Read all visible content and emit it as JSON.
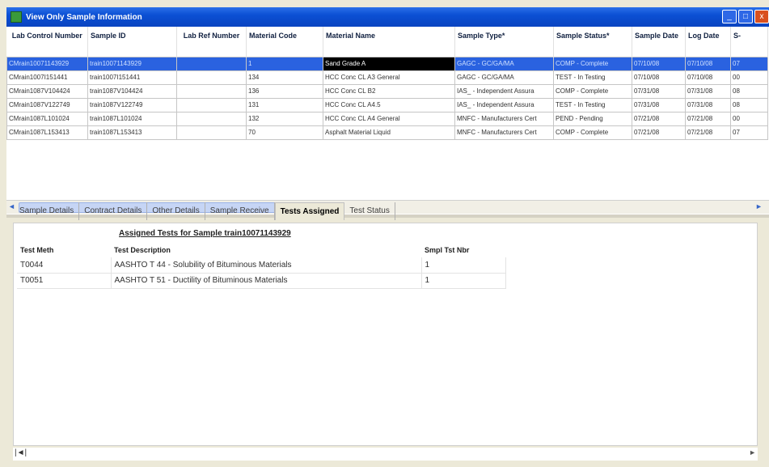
{
  "window": {
    "title": "View Only Sample Information",
    "minimize": "_",
    "maximize": "□",
    "close": "x"
  },
  "grid": {
    "columns": [
      "Lab Control Number",
      "Sample ID",
      "Lab Ref Number",
      "Material Code",
      "Material Name",
      "Sample Type*",
      "Sample Status*",
      "Sample Date",
      "Log Date",
      "S-"
    ],
    "rows": [
      [
        "CMrain10071143929",
        "train10071143929",
        "",
        "1",
        "Sand Grade A",
        "GAGC - GC/GA/MA",
        "COMP - Complete",
        "07/10/08",
        "07/10/08",
        "07"
      ],
      [
        "CMrain1007I151441",
        "train1007I151441",
        "",
        "134",
        "HCC Conc CL A3 General",
        "GAGC - GC/GA/MA",
        "TEST - In Testing",
        "07/10/08",
        "07/10/08",
        "00"
      ],
      [
        "CMrain1087V104424",
        "train1087V104424",
        "",
        "136",
        "HCC Conc CL B2",
        "IAS_ - Independent Assura",
        "COMP - Complete",
        "07/31/08",
        "07/31/08",
        "08"
      ],
      [
        "CMrain1087V122749",
        "train1087V122749",
        "",
        "131",
        "HCC Conc CL A4.5",
        "IAS_ - Independent Assura",
        "TEST - In Testing",
        "07/31/08",
        "07/31/08",
        "08"
      ],
      [
        "CMrain1087L101024",
        "train1087L101024",
        "",
        "132",
        "HCC Conc CL A4 General",
        "MNFC - Manufacturers Cert",
        "PEND - Pending",
        "07/21/08",
        "07/21/08",
        "00"
      ],
      [
        "CMrain1087L153413",
        "train1087L153413",
        "",
        "70",
        "Asphalt Material Liquid",
        "MNFC - Manufacturers Cert",
        "COMP - Complete",
        "07/21/08",
        "07/21/08",
        "07"
      ]
    ]
  },
  "scroll": {
    "left": "◄",
    "right": "►"
  },
  "tabs": [
    "Sample Details",
    "Contract Details",
    "Other Details",
    "Sample Receive",
    "Tests Assigned",
    "Test Status"
  ],
  "panel": {
    "title": "Assigned Tests for Sample train10071143929",
    "headers": [
      "Test Meth",
      "Test Description",
      "Smpl Tst Nbr"
    ],
    "rows": [
      [
        "T0044",
        "AASHTO T 44 -  Solubility of Bituminous Materials",
        "1"
      ],
      [
        "T0051",
        "AASHTO T 51 - Ductility of Bituminous Materials",
        "1"
      ]
    ]
  },
  "bottom": {
    "left": "|◄|",
    "right": "►"
  }
}
